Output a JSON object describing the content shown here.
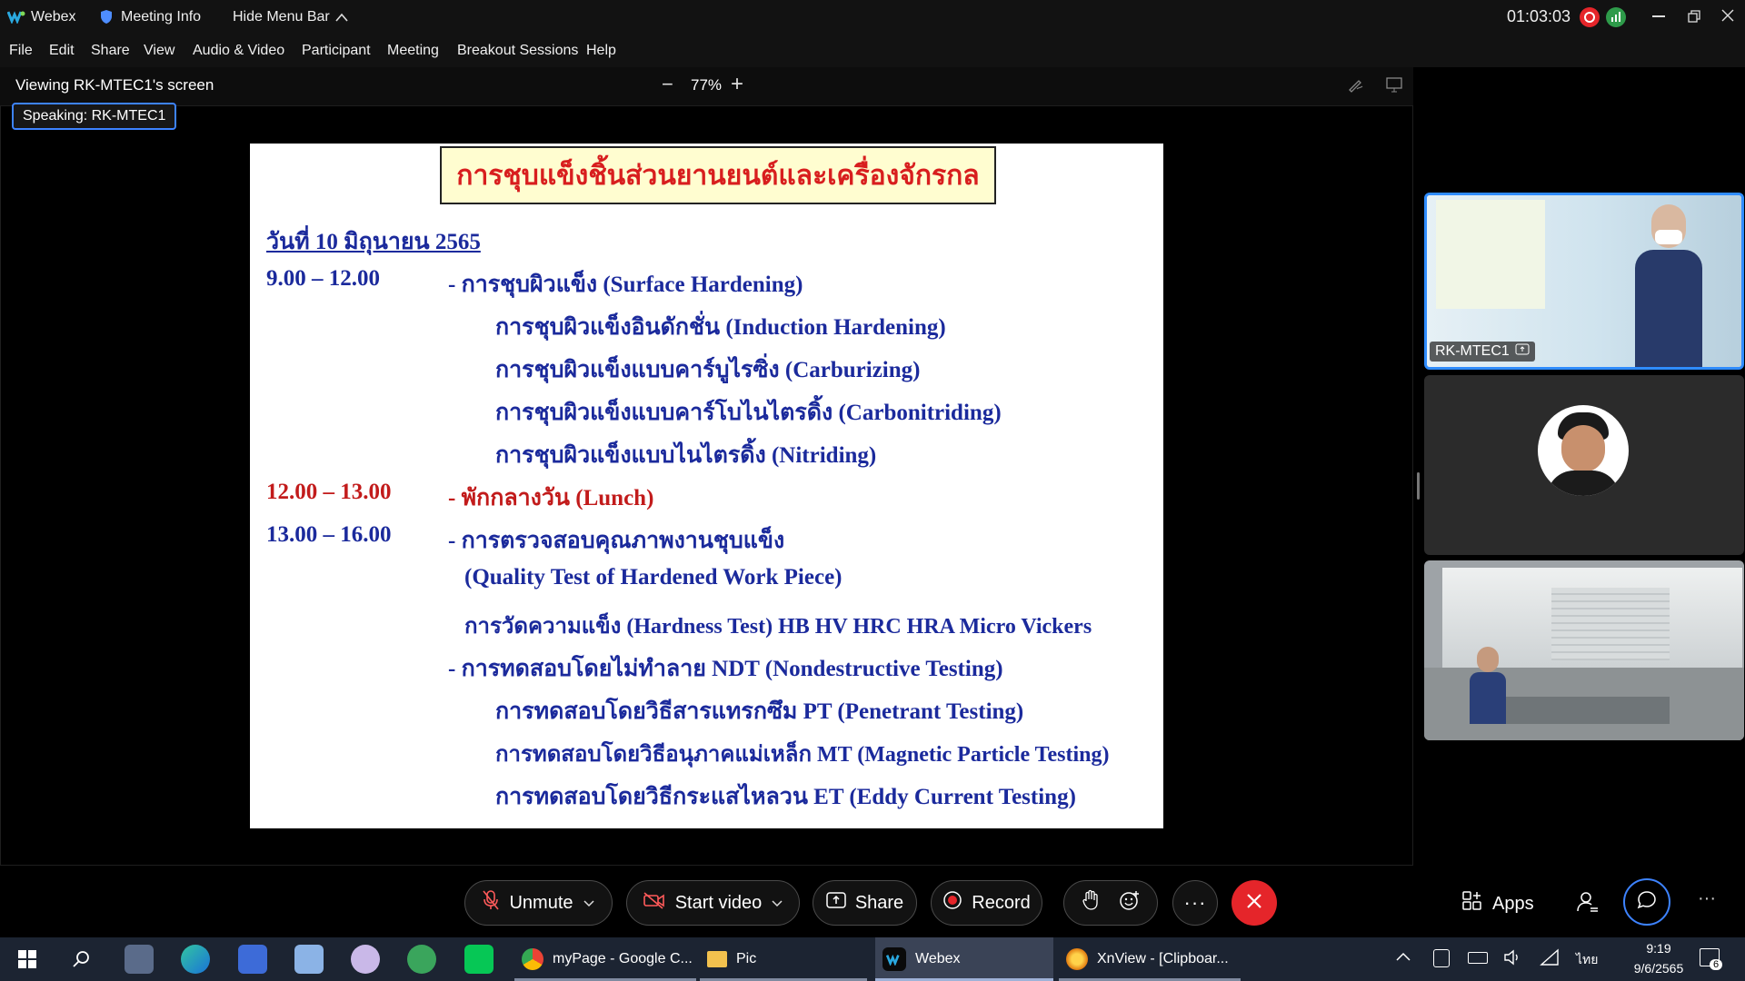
{
  "titlebar": {
    "app_name": "Webex",
    "meeting_info": "Meeting Info",
    "hide_menu_bar": "Hide Menu Bar",
    "timer": "01:03:03"
  },
  "menu": [
    "File",
    "Edit",
    "Share",
    "View",
    "Audio & Video",
    "Participant",
    "Meeting",
    "Breakout Sessions",
    "Help"
  ],
  "viewer": {
    "label": "Viewing RK-MTEC1's screen",
    "zoom": "77%",
    "zoom_out": "−",
    "zoom_in": "+",
    "speaking": "Speaking: RK-MTEC1"
  },
  "slide": {
    "title": "การชุบแข็งชิ้นส่วนยานยนต์และเครื่องจักรกล",
    "date": "วันที่ 10 มิถุนายน 2565",
    "lines": [
      {
        "time": "9.00 – 12.00",
        "text": "- การชุบผิวแข็ง (Surface Hardening)"
      },
      {
        "time": "",
        "text": "การชุบผิวแข็งอินดักชั่น (Induction Hardening)"
      },
      {
        "time": "",
        "text": "การชุบผิวแข็งแบบคาร์บูไรซิ่ง (Carburizing)"
      },
      {
        "time": "",
        "text": "การชุบผิวแข็งแบบคาร์โบไนไตรดิ้ง (Carbonitriding)"
      },
      {
        "time": "",
        "text": "การชุบผิวแข็งแบบไนไตรดิ้ง (Nitriding)"
      },
      {
        "time": "12.00  – 13.00",
        "text": "- พักกลางวัน (Lunch)"
      },
      {
        "time": "13.00 – 16.00",
        "text": "- การตรวจสอบคุณภาพงานชุบแข็ง"
      },
      {
        "time": "",
        "text": "(Quality Test  of  Hardened Work Piece)"
      },
      {
        "time": "",
        "text": "การวัดความแข็ง (Hardness Test) HB HV HRC HRA Micro Vickers"
      },
      {
        "time": "",
        "text": "- การทดสอบโดยไม่ทำลาย  NDT (Nondestructive Testing)"
      },
      {
        "time": "",
        "text": "การทดสอบโดยวิธีสารแทรกซึม PT (Penetrant Testing)"
      },
      {
        "time": "",
        "text": "การทดสอบโดยวิธีอนุภาคแม่เหล็ก MT (Magnetic Particle Testing)"
      },
      {
        "time": "",
        "text": "การทดสอบโดยวิธีกระแสไหลวน ET (Eddy Current Testing)"
      }
    ]
  },
  "participants": [
    {
      "name": "RK-MTEC1"
    }
  ],
  "controls": {
    "unmute": "Unmute",
    "start_video": "Start video",
    "share": "Share",
    "record": "Record",
    "more": "···",
    "apps": "Apps"
  },
  "taskbar": {
    "apps": [
      {
        "label": "myPage - Google C..."
      },
      {
        "label": "Pic"
      },
      {
        "label": "Webex"
      },
      {
        "label": "XnView - [Clipboar..."
      }
    ],
    "language": "ไทย",
    "time": "9:19",
    "date": "9/6/2565",
    "notification_count": "6"
  },
  "colors": {
    "accent_blue": "#3d83ff",
    "end_call_red": "#e5252a",
    "slide_text_blue": "#1b2a9c",
    "slide_text_red": "#c21b1b"
  }
}
